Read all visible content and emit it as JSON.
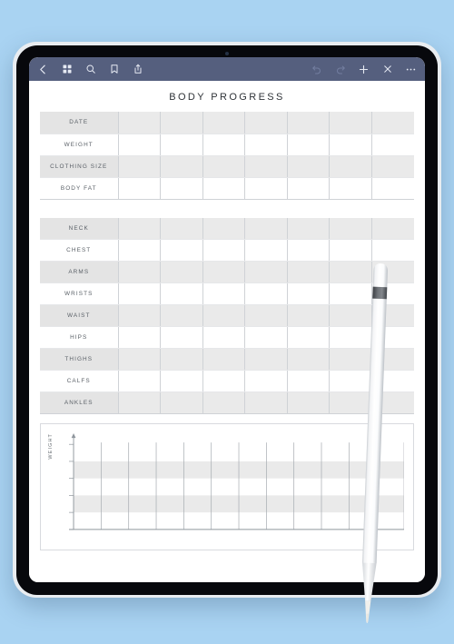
{
  "device": {
    "name": "tablet",
    "background_color": "#a9d3f2",
    "bezel_color": "#07080c",
    "frame_color": "#e9edf1"
  },
  "toolbar": {
    "background_color": "#555f7e",
    "left_items": [
      {
        "name": "back-icon",
        "label": "Back",
        "state": "enabled"
      },
      {
        "name": "grid-icon",
        "label": "Thumbnails",
        "state": "enabled"
      },
      {
        "name": "search-icon",
        "label": "Search",
        "state": "enabled"
      },
      {
        "name": "bookmark-icon",
        "label": "Bookmark",
        "state": "enabled"
      },
      {
        "name": "share-icon",
        "label": "Share",
        "state": "enabled"
      }
    ],
    "right_items": [
      {
        "name": "undo-icon",
        "label": "Undo",
        "state": "disabled"
      },
      {
        "name": "redo-icon",
        "label": "Redo",
        "state": "disabled"
      },
      {
        "name": "add-icon",
        "label": "Add",
        "state": "enabled"
      },
      {
        "name": "close-icon",
        "label": "Close",
        "state": "enabled"
      },
      {
        "name": "more-icon",
        "label": "More",
        "state": "enabled"
      }
    ]
  },
  "document": {
    "title": "BODY PROGRESS",
    "columns_count": 7,
    "tables": [
      {
        "id": "general-measurements",
        "rows": [
          {
            "label": "DATE",
            "shaded": true,
            "values": [
              "",
              "",
              "",
              "",
              "",
              "",
              ""
            ]
          },
          {
            "label": "WEIGHT",
            "shaded": false,
            "values": [
              "",
              "",
              "",
              "",
              "",
              "",
              ""
            ]
          },
          {
            "label": "CLOTHING SIZE",
            "shaded": true,
            "values": [
              "",
              "",
              "",
              "",
              "",
              "",
              ""
            ]
          },
          {
            "label": "BODY FAT",
            "shaded": false,
            "values": [
              "",
              "",
              "",
              "",
              "",
              "",
              ""
            ]
          }
        ]
      },
      {
        "id": "body-measurements",
        "rows": [
          {
            "label": "NECK",
            "shaded": true,
            "values": [
              "",
              "",
              "",
              "",
              "",
              "",
              ""
            ]
          },
          {
            "label": "CHEST",
            "shaded": false,
            "values": [
              "",
              "",
              "",
              "",
              "",
              "",
              ""
            ]
          },
          {
            "label": "ARMS",
            "shaded": true,
            "values": [
              "",
              "",
              "",
              "",
              "",
              "",
              ""
            ]
          },
          {
            "label": "WRISTS",
            "shaded": false,
            "values": [
              "",
              "",
              "",
              "",
              "",
              "",
              ""
            ]
          },
          {
            "label": "WAIST",
            "shaded": true,
            "values": [
              "",
              "",
              "",
              "",
              "",
              "",
              ""
            ]
          },
          {
            "label": "HIPS",
            "shaded": false,
            "values": [
              "",
              "",
              "",
              "",
              "",
              "",
              ""
            ]
          },
          {
            "label": "THIGHS",
            "shaded": true,
            "values": [
              "",
              "",
              "",
              "",
              "",
              "",
              ""
            ]
          },
          {
            "label": "CALFS",
            "shaded": false,
            "values": [
              "",
              "",
              "",
              "",
              "",
              "",
              ""
            ]
          },
          {
            "label": "ANKLES",
            "shaded": true,
            "values": [
              "",
              "",
              "",
              "",
              "",
              "",
              ""
            ]
          }
        ]
      }
    ]
  },
  "chart_data": {
    "type": "line",
    "title": "",
    "xlabel": "",
    "ylabel": "WEIGHT",
    "x": [],
    "values": [],
    "series": [],
    "grid": true,
    "legend": "none",
    "x_gridlines": 13,
    "y_bands": 5,
    "band_shaded": [
      false,
      true,
      false,
      true,
      false
    ],
    "band_color": "#eaeaea",
    "axis_color": "#8f969d",
    "note": "empty printable chart grid; no data plotted"
  },
  "stylus": {
    "name": "apple-pencil",
    "body_color": "#ffffff",
    "band_color": "#4f5257"
  }
}
